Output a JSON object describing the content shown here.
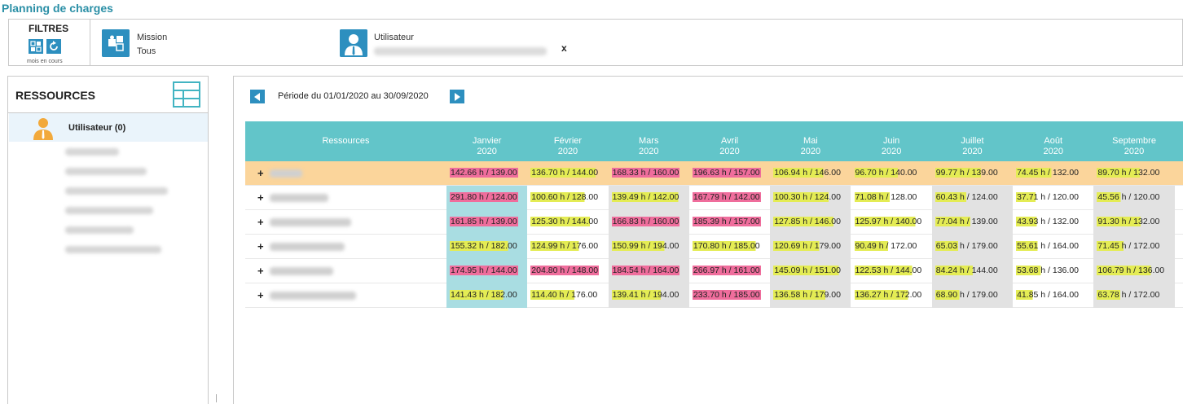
{
  "app": {
    "title": "Planning de charges"
  },
  "filters": {
    "title": "FILTRES",
    "caption": "mois en cours",
    "mission": {
      "label": "Mission",
      "value": "Tous"
    },
    "user": {
      "label": "Utilisateur",
      "clear": "x"
    }
  },
  "resources_panel": {
    "title": "RESSOURCES",
    "group_label": "Utilisateur (0)"
  },
  "period": {
    "text": "Période du 01/01/2020 au 30/09/2020"
  },
  "table": {
    "resource_header": "Ressources",
    "months": [
      {
        "name": "Janvier",
        "year": "2020"
      },
      {
        "name": "Février",
        "year": "2020"
      },
      {
        "name": "Mars",
        "year": "2020"
      },
      {
        "name": "Avril",
        "year": "2020"
      },
      {
        "name": "Mai",
        "year": "2020"
      },
      {
        "name": "Juin",
        "year": "2020"
      },
      {
        "name": "Juillet",
        "year": "2020"
      },
      {
        "name": "Août",
        "year": "2020"
      },
      {
        "name": "Septembre",
        "year": "2020"
      }
    ],
    "rows": [
      {
        "expand": "+",
        "selected": true,
        "cells": [
          "142.66 h / 139.00",
          "136.70 h / 144.00",
          "168.33 h / 160.00",
          "196.63 h / 157.00",
          "106.94 h / 146.00",
          "96.70 h / 140.00",
          "99.77 h / 139.00",
          "74.45 h / 132.00",
          "89.70 h / 132.00"
        ],
        "ratios": [
          1.03,
          0.95,
          1.05,
          1.25,
          0.73,
          0.69,
          0.72,
          0.56,
          0.68
        ]
      },
      {
        "expand": "+",
        "selected": false,
        "cells": [
          "291.80 h / 124.00",
          "100.60 h / 128.00",
          "139.49 h / 142.00",
          "167.79 h / 142.00",
          "100.30 h / 124.00",
          "71.08 h / 128.00",
          "60.43 h / 124.00",
          "37.71 h / 120.00",
          "45.56 h / 120.00"
        ],
        "ratios": [
          2.35,
          0.79,
          0.98,
          1.18,
          0.81,
          0.56,
          0.49,
          0.31,
          0.38
        ]
      },
      {
        "expand": "+",
        "selected": false,
        "cells": [
          "161.85 h / 139.00",
          "125.30 h / 144.00",
          "166.83 h / 160.00",
          "185.39 h / 157.00",
          "127.85 h / 146.00",
          "125.97 h / 140.00",
          "77.04 h / 139.00",
          "43.93 h / 132.00",
          "91.30 h / 132.00"
        ],
        "ratios": [
          1.16,
          0.87,
          1.04,
          1.18,
          0.88,
          0.9,
          0.55,
          0.33,
          0.69
        ]
      },
      {
        "expand": "+",
        "selected": false,
        "cells": [
          "155.32 h / 182.00",
          "124.99 h / 176.00",
          "150.99 h / 194.00",
          "170.80 h / 185.00",
          "120.69 h / 179.00",
          "90.49 h / 172.00",
          "65.03 h / 179.00",
          "55.61 h / 164.00",
          "71.45 h / 172.00"
        ],
        "ratios": [
          0.85,
          0.71,
          0.78,
          0.92,
          0.67,
          0.53,
          0.36,
          0.34,
          0.42
        ]
      },
      {
        "expand": "+",
        "selected": false,
        "cells": [
          "174.95 h / 144.00",
          "204.80 h / 148.00",
          "184.54 h / 164.00",
          "266.97 h / 161.00",
          "145.09 h / 151.00",
          "122.53 h / 144.00",
          "84.24 h / 144.00",
          "53.68 h / 136.00",
          "106.79 h / 136.00"
        ],
        "ratios": [
          1.21,
          1.38,
          1.13,
          1.66,
          0.96,
          0.85,
          0.59,
          0.39,
          0.79
        ]
      },
      {
        "expand": "+",
        "selected": false,
        "cells": [
          "141.43 h / 182.00",
          "114.40 h / 176.00",
          "139.41 h / 194.00",
          "233.70 h / 185.00",
          "136.58 h / 179.00",
          "136.27 h / 172.00",
          "68.90 h / 179.00",
          "41.85 h / 164.00",
          "63.78 h / 172.00"
        ],
        "ratios": [
          0.78,
          0.65,
          0.72,
          1.26,
          0.76,
          0.79,
          0.38,
          0.26,
          0.37
        ]
      }
    ]
  },
  "colors": {
    "accent": "#62c5c9",
    "over": "#ef6d9c",
    "under": "#e4ec54",
    "selected_row": "#fbd59b",
    "brand": "#2a8fa6"
  }
}
